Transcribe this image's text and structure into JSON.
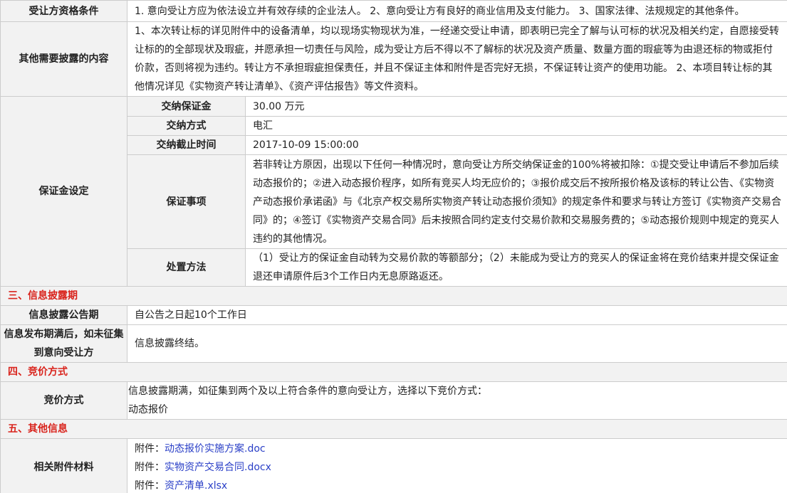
{
  "qualification": {
    "label": "受让方资格条件",
    "value": "1. 意向受让方应为依法设立并有效存续的企业法人。 2、意向受让方有良好的商业信用及支付能力。 3、国家法律、法规规定的其他条件。"
  },
  "other_disclosure": {
    "label": "其他需要披露的内容",
    "value": "1、本次转让标的详见附件中的设备清单，均以现场实物现状为准，一经递交受让申请，即表明已完全了解与认可标的状况及相关约定，自愿接受转让标的的全部现状及瑕疵，并愿承担一切责任与风险，成为受让方后不得以不了解标的状况及资产质量、数量方面的瑕疵等为由退还标的物或拒付价款，否则将视为违约。转让方不承担瑕疵担保责任，并且不保证主体和附件是否完好无损，不保证转让资产的使用功能。 2、本项目转让标的其他情况详见《实物资产转让清单》、《资产评估报告》等文件资料。"
  },
  "deposit": {
    "label": "保证金设定",
    "rows": [
      {
        "label": "交纳保证金",
        "value": "30.00 万元"
      },
      {
        "label": "交纳方式",
        "value": "电汇"
      },
      {
        "label": "交纳截止时间",
        "value": "2017-10-09 15:00:00"
      },
      {
        "label": "保证事项",
        "value": "若非转让方原因，出现以下任何一种情况时，意向受让方所交纳保证金的100%将被扣除：①提交受让申请后不参加后续动态报价的；②进入动态报价程序，如所有竞买人均无应价的；③报价成交后不按所报价格及该标的转让公告、《实物资产动态报价承诺函》与《北京产权交易所实物资产转让动态报价须知》的规定条件和要求与转让方签订《实物资产交易合同》的；④签订《实物资产交易合同》后未按照合同约定支付交易价款和交易服务费的；⑤动态报价规则中规定的竞买人违约的其他情况。"
      },
      {
        "label": "处置方法",
        "value": "（1）受让方的保证金自动转为交易价款的等额部分；（2）未能成为受让方的竞买人的保证金将在竞价结束并提交保证金退还申请原件后3个工作日内无息原路返还。"
      }
    ]
  },
  "section3": {
    "title": "三、信息披露期",
    "rows": [
      {
        "label": "信息披露公告期",
        "value": "自公告之日起10个工作日"
      },
      {
        "label": "信息发布期满后，如未征集到意向受让方",
        "value": "信息披露终结。"
      }
    ]
  },
  "section4": {
    "title": "四、竞价方式",
    "label": "竞价方式",
    "line1": "信息披露期满，如征集到两个及以上符合条件的意向受让方，选择以下竞价方式：",
    "line2": "动态报价"
  },
  "section5": {
    "title": "五、其他信息",
    "label": "相关附件材料",
    "attachments": [
      {
        "prefix": "附件：",
        "name": "动态报价实施方案.doc"
      },
      {
        "prefix": "附件：",
        "name": "实物资产交易合同.docx"
      },
      {
        "prefix": "附件：",
        "name": "资产清单.xlsx"
      }
    ]
  }
}
